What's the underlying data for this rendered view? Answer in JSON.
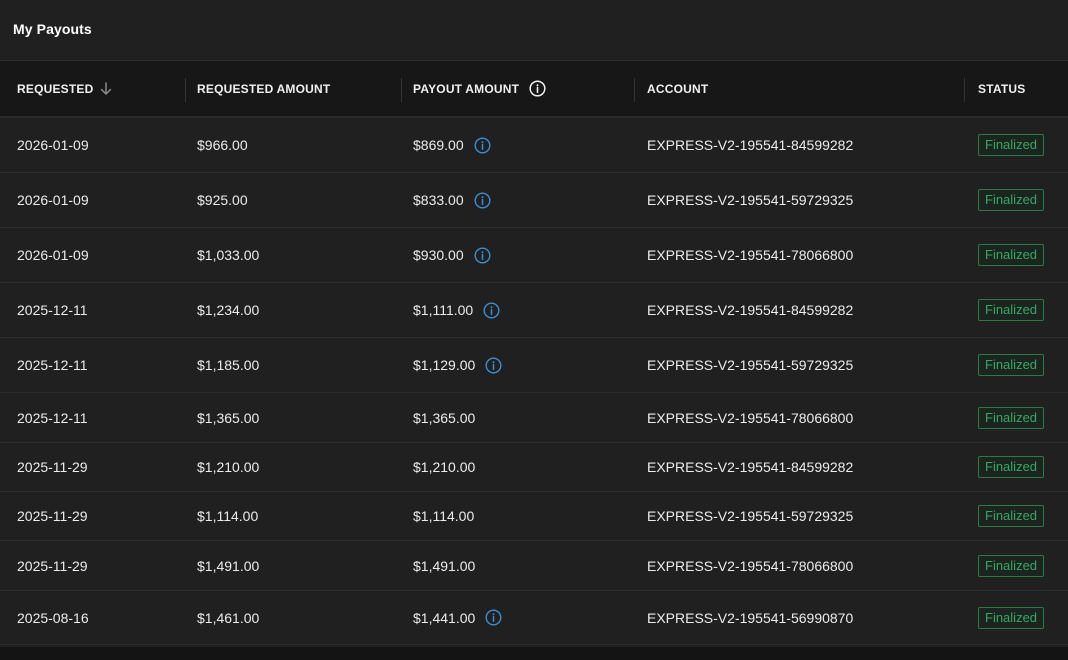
{
  "header": {
    "title": "My Payouts"
  },
  "table": {
    "columns": {
      "requested": "REQUESTED",
      "requested_amount": "REQUESTED AMOUNT",
      "payout_amount": "PAYOUT AMOUNT",
      "account": "ACCOUNT",
      "status": "STATUS"
    },
    "sort": {
      "column": "requested",
      "direction": "descending",
      "icon": "arrow-down-icon"
    },
    "rows": [
      {
        "requested": "2026-01-09",
        "requested_amount": "$966.00",
        "payout_amount": "$869.00",
        "has_info": true,
        "account": "EXPRESS-V2-195541-84599282",
        "status": "Finalized"
      },
      {
        "requested": "2026-01-09",
        "requested_amount": "$925.00",
        "payout_amount": "$833.00",
        "has_info": true,
        "account": "EXPRESS-V2-195541-59729325",
        "status": "Finalized"
      },
      {
        "requested": "2026-01-09",
        "requested_amount": "$1,033.00",
        "payout_amount": "$930.00",
        "has_info": true,
        "account": "EXPRESS-V2-195541-78066800",
        "status": "Finalized"
      },
      {
        "requested": "2025-12-11",
        "requested_amount": "$1,234.00",
        "payout_amount": "$1,111.00",
        "has_info": true,
        "account": "EXPRESS-V2-195541-84599282",
        "status": "Finalized"
      },
      {
        "requested": "2025-12-11",
        "requested_amount": "$1,185.00",
        "payout_amount": "$1,129.00",
        "has_info": true,
        "account": "EXPRESS-V2-195541-59729325",
        "status": "Finalized"
      },
      {
        "requested": "2025-12-11",
        "requested_amount": "$1,365.00",
        "payout_amount": "$1,365.00",
        "has_info": false,
        "account": "EXPRESS-V2-195541-78066800",
        "status": "Finalized"
      },
      {
        "requested": "2025-11-29",
        "requested_amount": "$1,210.00",
        "payout_amount": "$1,210.00",
        "has_info": false,
        "account": "EXPRESS-V2-195541-84599282",
        "status": "Finalized"
      },
      {
        "requested": "2025-11-29",
        "requested_amount": "$1,114.00",
        "payout_amount": "$1,114.00",
        "has_info": false,
        "account": "EXPRESS-V2-195541-59729325",
        "status": "Finalized"
      },
      {
        "requested": "2025-11-29",
        "requested_amount": "$1,491.00",
        "payout_amount": "$1,491.00",
        "has_info": false,
        "account": "EXPRESS-V2-195541-78066800",
        "status": "Finalized"
      },
      {
        "requested": "2025-08-16",
        "requested_amount": "$1,461.00",
        "payout_amount": "$1,441.00",
        "has_info": true,
        "account": "EXPRESS-V2-195541-56990870",
        "status": "Finalized"
      }
    ]
  },
  "colors": {
    "background": "#202020",
    "header_bg": "#171717",
    "status_green": "#35a862",
    "info_blue": "#3b8fd6"
  }
}
